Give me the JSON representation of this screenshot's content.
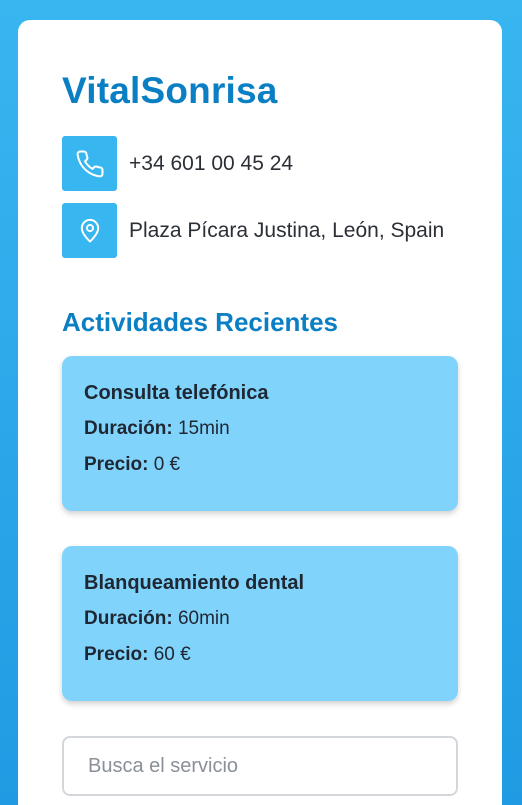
{
  "brand": {
    "name": "VitalSonrisa",
    "color": "#0a7fc4"
  },
  "contact": {
    "phone": "+34 601 00 45 24",
    "address": "Plaza Pícara Justina, León, Spain",
    "phone_icon": "phone-icon",
    "location_icon": "location-pin-icon"
  },
  "activities": {
    "title": "Actividades Recientes",
    "items": [
      {
        "name": "Consulta telefónica",
        "duration_label": "Duración:",
        "duration_value": "15min",
        "price_label": "Precio:",
        "price_value": "0 €"
      },
      {
        "name": "Blanqueamiento dental",
        "duration_label": "Duración:",
        "duration_value": "60min",
        "price_label": "Precio:",
        "price_value": "60 €"
      }
    ]
  },
  "search": {
    "placeholder": "Busca el servicio",
    "value": ""
  },
  "colors": {
    "background": "#38b6f0",
    "icon_box": "#38b6f0",
    "activity_card": "#80d3fb"
  }
}
